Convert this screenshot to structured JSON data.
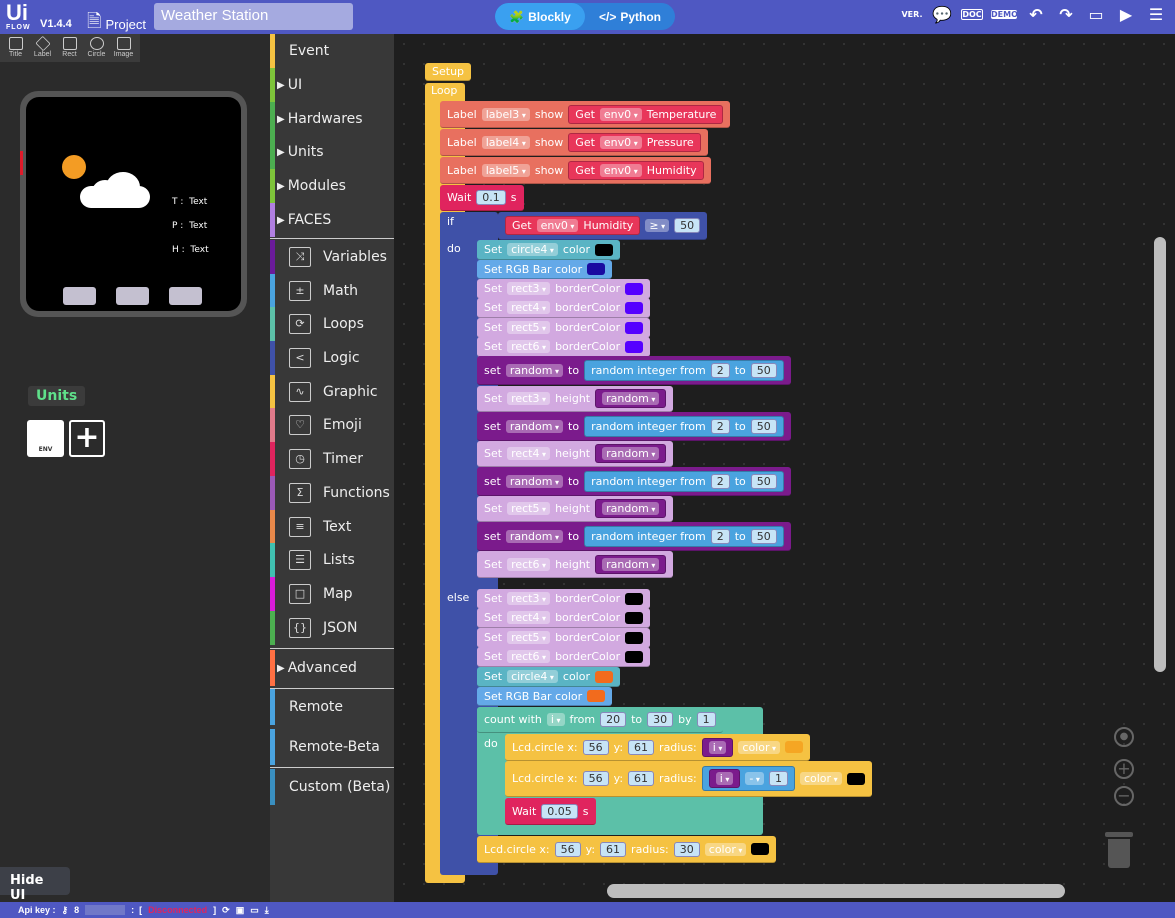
{
  "topbar": {
    "logo": "Ui",
    "logo_sub": "FLOW",
    "version": "V1.4.4",
    "project_label": "Project",
    "project_name": "Weather Station",
    "mode_blockly": "Blockly",
    "mode_python": "Python",
    "tools": [
      "version-icon",
      "chat-icon",
      "doc-icon",
      "demo-icon",
      "undo-icon",
      "redo-icon",
      "screen-icon",
      "run-icon",
      "menu-icon"
    ],
    "ver_text": "VER.",
    "doc_text": "DOC",
    "demo_text": "DEMO"
  },
  "shapes": [
    "Title",
    "Label",
    "Rect",
    "Circle",
    "Image"
  ],
  "device": {
    "labels": [
      "T :",
      "P :",
      "H :"
    ],
    "values": [
      "Text",
      "Text",
      "Text"
    ],
    "sun_color": "#f39c24"
  },
  "units": {
    "title": "Units",
    "unit_name": "ENV"
  },
  "hide_ui": "Hide UI",
  "sidebar": {
    "items": [
      {
        "label": "Event",
        "color": "#f5c242",
        "arrow": ""
      },
      {
        "label": "UI",
        "color": "#7ec43a",
        "arrow": "▶"
      },
      {
        "label": "Hardwares",
        "color": "#4cae50",
        "arrow": "▶"
      },
      {
        "label": "Units",
        "color": "#4cae50",
        "arrow": "▶"
      },
      {
        "label": "Modules",
        "color": "#7ec43a",
        "arrow": "▶"
      },
      {
        "label": "FACES",
        "color": "#b07fe0",
        "arrow": "▶"
      },
      {
        "label": "Variables",
        "color": "#6a1b9a",
        "icon": "⤨"
      },
      {
        "label": "Math",
        "color": "#4aa3df",
        "icon": "±"
      },
      {
        "label": "Loops",
        "color": "#5cc0a8",
        "icon": "⟳"
      },
      {
        "label": "Logic",
        "color": "#3f51a8",
        "icon": "<"
      },
      {
        "label": "Graphic",
        "color": "#f5c242",
        "icon": "∿"
      },
      {
        "label": "Emoji",
        "color": "#e07a8a",
        "icon": "♡"
      },
      {
        "label": "Timer",
        "color": "#e0245e",
        "icon": "◷"
      },
      {
        "label": "Functions",
        "color": "#9b59b6",
        "icon": "Σ"
      },
      {
        "label": "Text",
        "color": "#e8884a",
        "icon": "≡"
      },
      {
        "label": "Lists",
        "color": "#40c0b0",
        "icon": "☰"
      },
      {
        "label": "Map",
        "color": "#d81bd8",
        "icon": "□"
      },
      {
        "label": "JSON",
        "color": "#4caf50",
        "icon": "{}"
      },
      {
        "label": "Advanced",
        "color": "#ff7043",
        "arrow": "▶"
      },
      {
        "label": "Remote",
        "color": "#4aa3df",
        "arrow": ""
      },
      {
        "label": "Remote-Beta",
        "color": "#4aa3df",
        "arrow": ""
      },
      {
        "label": "Custom (Beta)",
        "color": "#3a8fc0",
        "arrow": ""
      }
    ]
  },
  "workspace": {
    "containers": [
      {
        "name": "loop",
        "color": "#f5c242",
        "label": "Loop"
      },
      {
        "name": "if",
        "color": "#3f51a8",
        "labels": [
          "if",
          "do",
          "else"
        ]
      },
      {
        "name": "count",
        "color": "#5cc0a8",
        "labels": [
          "count with",
          "do"
        ]
      }
    ],
    "blocks": [
      {
        "color": "#f5c242",
        "parts": [
          [
            "t",
            "Setup"
          ]
        ]
      },
      {
        "color": "#e8705f",
        "parts": [
          [
            "t",
            "Label"
          ],
          [
            "d",
            "label3"
          ],
          [
            "t",
            "show"
          ],
          [
            "i",
            "#e8365a",
            [
              [
                "t",
                "Get"
              ],
              [
                "d",
                "env0"
              ],
              [
                "t",
                "Temperature"
              ]
            ]
          ]
        ]
      },
      {
        "color": "#e8705f",
        "parts": [
          [
            "t",
            "Label"
          ],
          [
            "d",
            "label4"
          ],
          [
            "t",
            "show"
          ],
          [
            "i",
            "#e8365a",
            [
              [
                "t",
                "Get"
              ],
              [
                "d",
                "env0"
              ],
              [
                "t",
                "Pressure"
              ]
            ]
          ]
        ]
      },
      {
        "color": "#e8705f",
        "parts": [
          [
            "t",
            "Label"
          ],
          [
            "d",
            "label5"
          ],
          [
            "t",
            "show"
          ],
          [
            "i",
            "#e8365a",
            [
              [
                "t",
                "Get"
              ],
              [
                "d",
                "env0"
              ],
              [
                "t",
                "Humidity"
              ]
            ]
          ]
        ]
      },
      {
        "color": "#e0245e",
        "parts": [
          [
            "t",
            "Wait"
          ],
          [
            "n",
            "0.1"
          ],
          [
            "t",
            "s"
          ]
        ]
      },
      {
        "color": "#3f51a8",
        "parts": [
          [
            "i",
            "#e8365a",
            [
              [
                "t",
                "Get"
              ],
              [
                "d",
                "env0"
              ],
              [
                "t",
                "Humidity"
              ]
            ]
          ],
          [
            "d",
            "≥"
          ],
          [
            "n",
            "50"
          ]
        ]
      },
      {
        "color": "#5ab4c4",
        "parts": [
          [
            "t",
            "Set"
          ],
          [
            "d",
            "circle4"
          ],
          [
            "t",
            "color"
          ],
          [
            "s",
            "#000000"
          ]
        ]
      },
      {
        "color": "#64a9e8",
        "parts": [
          [
            "t",
            "Set RGB Bar color"
          ],
          [
            "s",
            "#1a0aa0"
          ]
        ]
      },
      {
        "color": "#d2a9e0",
        "parts": [
          [
            "t",
            "Set"
          ],
          [
            "d",
            "rect3"
          ],
          [
            "t",
            "borderColor"
          ],
          [
            "s",
            "#5500ff"
          ]
        ]
      },
      {
        "color": "#d2a9e0",
        "parts": [
          [
            "t",
            "Set"
          ],
          [
            "d",
            "rect4"
          ],
          [
            "t",
            "borderColor"
          ],
          [
            "s",
            "#5500ff"
          ]
        ]
      },
      {
        "color": "#d2a9e0",
        "parts": [
          [
            "t",
            "Set"
          ],
          [
            "d",
            "rect5"
          ],
          [
            "t",
            "borderColor"
          ],
          [
            "s",
            "#5500ff"
          ]
        ]
      },
      {
        "color": "#d2a9e0",
        "parts": [
          [
            "t",
            "Set"
          ],
          [
            "d",
            "rect6"
          ],
          [
            "t",
            "borderColor"
          ],
          [
            "s",
            "#5500ff"
          ]
        ]
      },
      {
        "color": "#7b1b8c",
        "parts": [
          [
            "t",
            "set"
          ],
          [
            "d",
            "random"
          ],
          [
            "t",
            "to"
          ],
          [
            "i",
            "#4aa3df",
            [
              [
                "t",
                "random integer from"
              ],
              [
                "n",
                "2"
              ],
              [
                "t",
                "to"
              ],
              [
                "n",
                "50"
              ]
            ]
          ]
        ]
      },
      {
        "color": "#d2a9e0",
        "parts": [
          [
            "t",
            "Set"
          ],
          [
            "d",
            "rect3"
          ],
          [
            "t",
            "height"
          ],
          [
            "i",
            "#7b1b8c",
            [
              [
                "d",
                "random"
              ]
            ]
          ]
        ]
      },
      {
        "color": "#7b1b8c",
        "parts": [
          [
            "t",
            "set"
          ],
          [
            "d",
            "random"
          ],
          [
            "t",
            "to"
          ],
          [
            "i",
            "#4aa3df",
            [
              [
                "t",
                "random integer from"
              ],
              [
                "n",
                "2"
              ],
              [
                "t",
                "to"
              ],
              [
                "n",
                "50"
              ]
            ]
          ]
        ]
      },
      {
        "color": "#d2a9e0",
        "parts": [
          [
            "t",
            "Set"
          ],
          [
            "d",
            "rect4"
          ],
          [
            "t",
            "height"
          ],
          [
            "i",
            "#7b1b8c",
            [
              [
                "d",
                "random"
              ]
            ]
          ]
        ]
      },
      {
        "color": "#7b1b8c",
        "parts": [
          [
            "t",
            "set"
          ],
          [
            "d",
            "random"
          ],
          [
            "t",
            "to"
          ],
          [
            "i",
            "#4aa3df",
            [
              [
                "t",
                "random integer from"
              ],
              [
                "n",
                "2"
              ],
              [
                "t",
                "to"
              ],
              [
                "n",
                "50"
              ]
            ]
          ]
        ]
      },
      {
        "color": "#d2a9e0",
        "parts": [
          [
            "t",
            "Set"
          ],
          [
            "d",
            "rect5"
          ],
          [
            "t",
            "height"
          ],
          [
            "i",
            "#7b1b8c",
            [
              [
                "d",
                "random"
              ]
            ]
          ]
        ]
      },
      {
        "color": "#7b1b8c",
        "parts": [
          [
            "t",
            "set"
          ],
          [
            "d",
            "random"
          ],
          [
            "t",
            "to"
          ],
          [
            "i",
            "#4aa3df",
            [
              [
                "t",
                "random integer from"
              ],
              [
                "n",
                "2"
              ],
              [
                "t",
                "to"
              ],
              [
                "n",
                "50"
              ]
            ]
          ]
        ]
      },
      {
        "color": "#d2a9e0",
        "parts": [
          [
            "t",
            "Set"
          ],
          [
            "d",
            "rect6"
          ],
          [
            "t",
            "height"
          ],
          [
            "i",
            "#7b1b8c",
            [
              [
                "d",
                "random"
              ]
            ]
          ]
        ]
      },
      {
        "color": "#d2a9e0",
        "parts": [
          [
            "t",
            "Set"
          ],
          [
            "d",
            "rect3"
          ],
          [
            "t",
            "borderColor"
          ],
          [
            "s",
            "#000000"
          ]
        ]
      },
      {
        "color": "#d2a9e0",
        "parts": [
          [
            "t",
            "Set"
          ],
          [
            "d",
            "rect4"
          ],
          [
            "t",
            "borderColor"
          ],
          [
            "s",
            "#000000"
          ]
        ]
      },
      {
        "color": "#d2a9e0",
        "parts": [
          [
            "t",
            "Set"
          ],
          [
            "d",
            "rect5"
          ],
          [
            "t",
            "borderColor"
          ],
          [
            "s",
            "#000000"
          ]
        ]
      },
      {
        "color": "#d2a9e0",
        "parts": [
          [
            "t",
            "Set"
          ],
          [
            "d",
            "rect6"
          ],
          [
            "t",
            "borderColor"
          ],
          [
            "s",
            "#000000"
          ]
        ]
      },
      {
        "color": "#5ab4c4",
        "parts": [
          [
            "t",
            "Set"
          ],
          [
            "d",
            "circle4"
          ],
          [
            "t",
            "color"
          ],
          [
            "s",
            "#f26b1d"
          ]
        ]
      },
      {
        "color": "#64a9e8",
        "parts": [
          [
            "t",
            "Set RGB Bar color"
          ],
          [
            "s",
            "#f26b1d"
          ]
        ]
      },
      {
        "color": "#5cc0a8",
        "parts": [
          [
            "t",
            "count with"
          ],
          [
            "d",
            "i"
          ],
          [
            "t",
            "from"
          ],
          [
            "n",
            "20"
          ],
          [
            "t",
            "to"
          ],
          [
            "n",
            "30"
          ],
          [
            "t",
            "by"
          ],
          [
            "n",
            "1"
          ]
        ]
      },
      {
        "color": "#f5c242",
        "parts": [
          [
            "t",
            "Lcd.circle x:"
          ],
          [
            "n",
            "56"
          ],
          [
            "t",
            "y:"
          ],
          [
            "n",
            "61"
          ],
          [
            "t",
            "radius:"
          ],
          [
            "i",
            "#7b1b8c",
            [
              [
                "d",
                "i"
              ]
            ]
          ],
          [
            "d",
            "color"
          ],
          [
            "s",
            "#f5a623"
          ]
        ]
      },
      {
        "color": "#f5c242",
        "parts": [
          [
            "t",
            "Lcd.circle x:"
          ],
          [
            "n",
            "56"
          ],
          [
            "t",
            "y:"
          ],
          [
            "n",
            "61"
          ],
          [
            "t",
            "radius:"
          ],
          [
            "i",
            "#4aa3df",
            [
              [
                "i",
                "#7b1b8c",
                [
                  [
                    "d",
                    "i"
                  ]
                ]
              ],
              [
                "d",
                "-"
              ],
              [
                "n",
                "1"
              ]
            ]
          ],
          [
            "d",
            "color"
          ],
          [
            "s",
            "#000000"
          ]
        ]
      },
      {
        "color": "#e0245e",
        "parts": [
          [
            "t",
            "Wait"
          ],
          [
            "n",
            "0.05"
          ],
          [
            "t",
            "s"
          ]
        ]
      },
      {
        "color": "#f5c242",
        "parts": [
          [
            "t",
            "Lcd.circle x:"
          ],
          [
            "n",
            "56"
          ],
          [
            "t",
            "y:"
          ],
          [
            "n",
            "61"
          ],
          [
            "t",
            "radius:"
          ],
          [
            "n",
            "30"
          ],
          [
            "d",
            "color"
          ],
          [
            "s",
            "#000000"
          ]
        ]
      }
    ]
  },
  "status": {
    "api_key_label": "Api key :",
    "api_key_value": "8",
    "connection": "Disconnected",
    "connection_color": "#e0245e"
  }
}
